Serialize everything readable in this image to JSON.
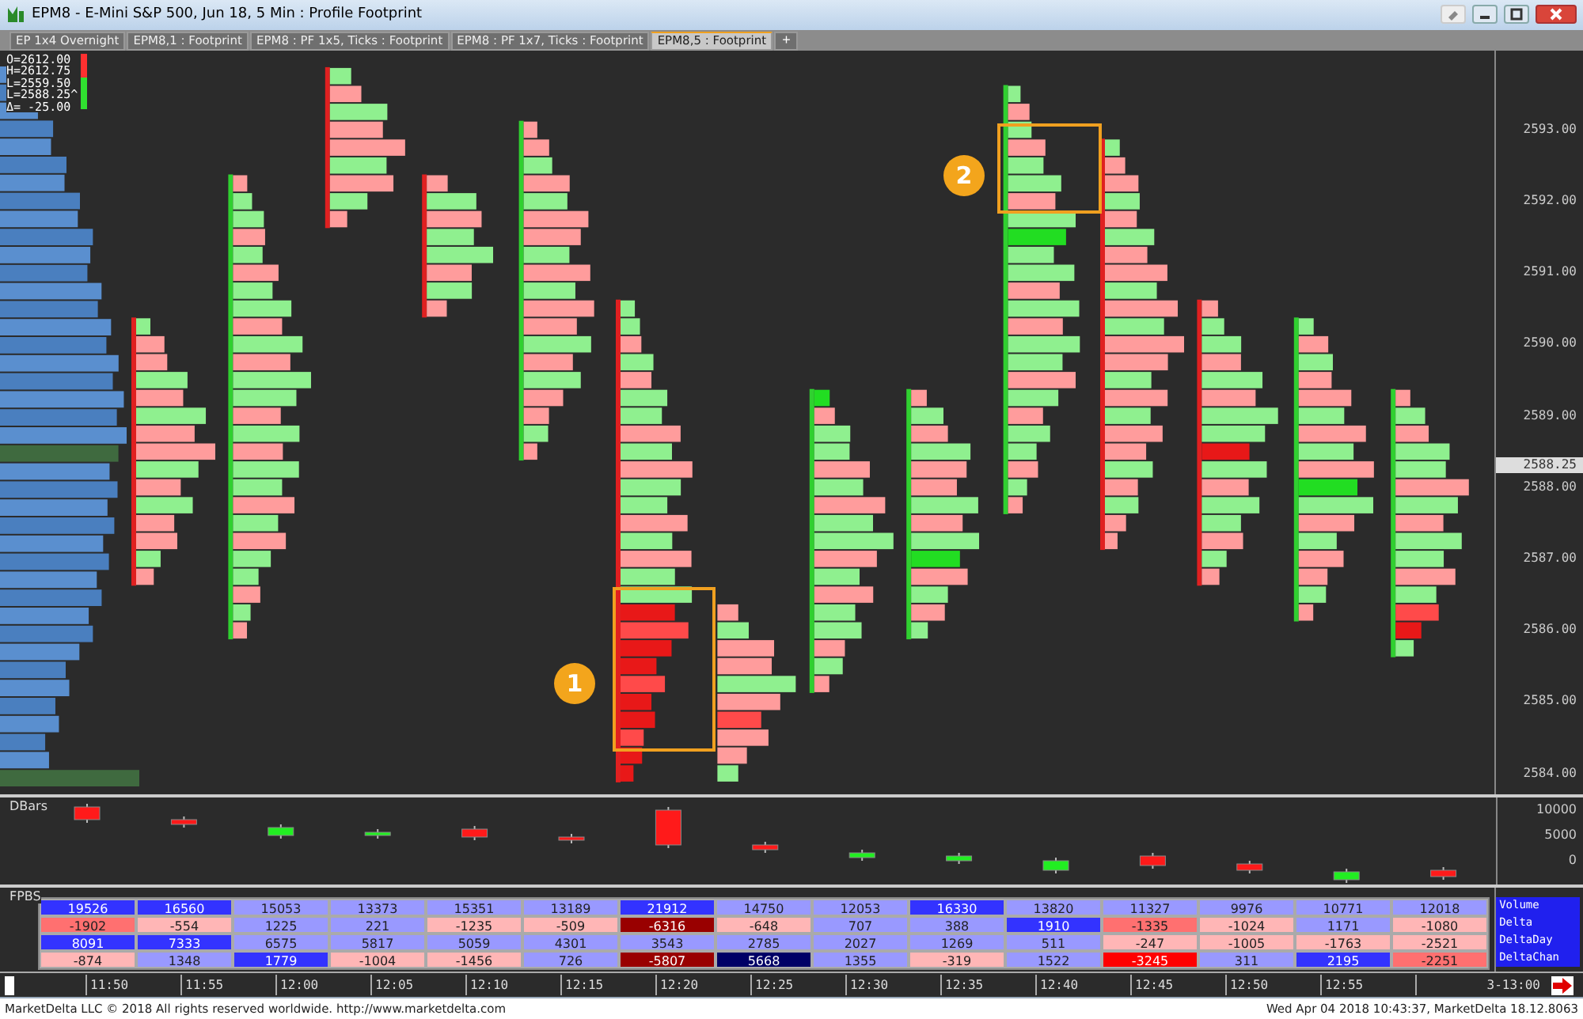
{
  "window": {
    "title": "EPM8 - E-Mini S&P 500, Jun 18, 5 Min : Profile Footprint"
  },
  "tabs": [
    {
      "label": "EP 1x4 Overnight",
      "selected": false
    },
    {
      "label": "EPM8,1 : Footprint",
      "selected": false
    },
    {
      "label": "EPM8 : PF 1x5, Ticks : Footprint",
      "selected": false
    },
    {
      "label": "EPM8 : PF 1x7, Ticks : Footprint",
      "selected": false
    },
    {
      "label": "EPM8,5 : Footprint",
      "selected": true
    }
  ],
  "new_tab_button": "+",
  "ohlc": [
    "O=2612.00",
    "H=2612.75",
    "L=2559.50",
    "L=2588.25^",
    "Δ= -25.00"
  ],
  "price_axis": {
    "labels": [
      "2593.00",
      "2592.00",
      "2591.00",
      "2590.00",
      "2589.00",
      "2588.00",
      "2587.00",
      "2586.00",
      "2585.00",
      "2584.00"
    ],
    "current": "2588.25"
  },
  "callouts": [
    {
      "label": "1"
    },
    {
      "label": "2"
    }
  ],
  "dbars": {
    "title": "DBars",
    "axis_labels": [
      "10000",
      "5000",
      "0"
    ]
  },
  "fpbs": {
    "title": "FPBS",
    "rows": [
      {
        "label": "Volume",
        "cells": [
          {
            "text": "19526",
            "color": "#3333ff"
          },
          {
            "text": "16560",
            "color": "#3333ff"
          },
          {
            "text": "15053",
            "color": "#9999ff"
          },
          {
            "text": "13373",
            "color": "#9999ff"
          },
          {
            "text": "15351",
            "color": "#9999ff"
          },
          {
            "text": "13189",
            "color": "#9999ff"
          },
          {
            "text": "21912",
            "color": "#3333ff"
          },
          {
            "text": "14750",
            "color": "#9999ff"
          },
          {
            "text": "12053",
            "color": "#9999ff"
          },
          {
            "text": "16330",
            "color": "#3333ff"
          },
          {
            "text": "13820",
            "color": "#9999ff"
          },
          {
            "text": "11327",
            "color": "#9999ff"
          },
          {
            "text": "9976",
            "color": "#9999ff"
          },
          {
            "text": "10771",
            "color": "#9999ff"
          },
          {
            "text": "12018",
            "color": "#9999ff"
          }
        ]
      },
      {
        "label": "Delta",
        "cells": [
          {
            "text": "-1902",
            "color": "#ff7070"
          },
          {
            "text": "-554",
            "color": "#ffb6b6"
          },
          {
            "text": "1225",
            "color": "#9999ff"
          },
          {
            "text": "221",
            "color": "#9999ff"
          },
          {
            "text": "-1235",
            "color": "#ffb6b6"
          },
          {
            "text": "-509",
            "color": "#ffb6b6"
          },
          {
            "text": "-6316",
            "color": "#990000"
          },
          {
            "text": "-648",
            "color": "#ffb6b6"
          },
          {
            "text": "707",
            "color": "#9999ff"
          },
          {
            "text": "388",
            "color": "#9999ff"
          },
          {
            "text": "1910",
            "color": "#3333ff"
          },
          {
            "text": "-1335",
            "color": "#ff7070"
          },
          {
            "text": "-1024",
            "color": "#ffb6b6"
          },
          {
            "text": "1171",
            "color": "#9999ff"
          },
          {
            "text": "-1080",
            "color": "#ffb6b6"
          }
        ]
      },
      {
        "label": "DeltaDay",
        "cells": [
          {
            "text": "8091",
            "color": "#3333ff"
          },
          {
            "text": "7333",
            "color": "#3333ff"
          },
          {
            "text": "6575",
            "color": "#9999ff"
          },
          {
            "text": "5817",
            "color": "#9999ff"
          },
          {
            "text": "5059",
            "color": "#9999ff"
          },
          {
            "text": "4301",
            "color": "#9999ff"
          },
          {
            "text": "3543",
            "color": "#9999ff"
          },
          {
            "text": "2785",
            "color": "#9999ff"
          },
          {
            "text": "2027",
            "color": "#9999ff"
          },
          {
            "text": "1269",
            "color": "#9999ff"
          },
          {
            "text": "511",
            "color": "#9999ff"
          },
          {
            "text": "-247",
            "color": "#ffb6b6"
          },
          {
            "text": "-1005",
            "color": "#ffb6b6"
          },
          {
            "text": "-1763",
            "color": "#ffb6b6"
          },
          {
            "text": "-2521",
            "color": "#ffb6b6"
          }
        ]
      },
      {
        "label": "DeltaChan",
        "cells": [
          {
            "text": "-874",
            "color": "#ffb6b6"
          },
          {
            "text": "1348",
            "color": "#9999ff"
          },
          {
            "text": "1779",
            "color": "#3333ff"
          },
          {
            "text": "-1004",
            "color": "#ffb6b6"
          },
          {
            "text": "-1456",
            "color": "#ffb6b6"
          },
          {
            "text": "726",
            "color": "#9999ff"
          },
          {
            "text": "-5807",
            "color": "#990000"
          },
          {
            "text": "5668",
            "color": "#000066"
          },
          {
            "text": "1355",
            "color": "#9999ff"
          },
          {
            "text": "-319",
            "color": "#ffb6b6"
          },
          {
            "text": "1522",
            "color": "#9999ff"
          },
          {
            "text": "-3245",
            "color": "#ff0000"
          },
          {
            "text": "311",
            "color": "#9999ff"
          },
          {
            "text": "2195",
            "color": "#3333ff"
          },
          {
            "text": "-2251",
            "color": "#ff7070"
          }
        ]
      }
    ]
  },
  "time_axis": [
    "11:50",
    "11:55",
    "12:00",
    "12:05",
    "12:10",
    "12:15",
    "12:20",
    "12:25",
    "12:30",
    "12:35",
    "12:40",
    "12:45",
    "12:50",
    "12:55",
    "3-13:00"
  ],
  "footer": {
    "left": "MarketDelta LLC © 2018 All rights reserved worldwide. http://www.marketdelta.com",
    "right": "Wed Apr 04 2018 10:43:37, MarketDelta 18.12.8063"
  }
}
